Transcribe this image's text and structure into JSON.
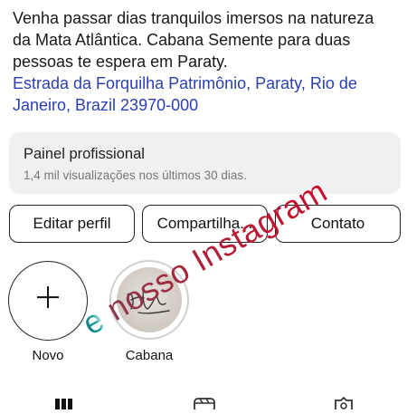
{
  "profile": {
    "bio_lines": [
      "Venha passar dias tranquilos imersos na natureza",
      "da Mata Atlântica. Cabana Semente para duas",
      "pessoas te espera em Paraty."
    ],
    "address_lines": [
      "Estrada da Forquilha Patrimônio, Paraty, Rio de",
      "Janeiro, Brazil 23970-000"
    ]
  },
  "panel": {
    "title": "Painel profissional",
    "subtitle": "1,4 mil visualizações nos últimos 30 dias."
  },
  "buttons": {
    "edit": "Editar perfil",
    "share": "Compartilha...",
    "contact": "Contato"
  },
  "highlights": {
    "new_label": "Novo",
    "items": [
      {
        "label": "Cabana"
      }
    ]
  },
  "watermark": {
    "prefix": "e",
    "text": "nosso Instagram"
  },
  "tabs": [
    {
      "icon": "grid-icon"
    },
    {
      "icon": "reels-icon"
    },
    {
      "icon": "tagged-icon"
    }
  ],
  "colors": {
    "link": "#2c3fb2",
    "panel_bg": "#eff0f2",
    "watermark_red": "#c8102e",
    "watermark_teal": "#0a7b82"
  }
}
